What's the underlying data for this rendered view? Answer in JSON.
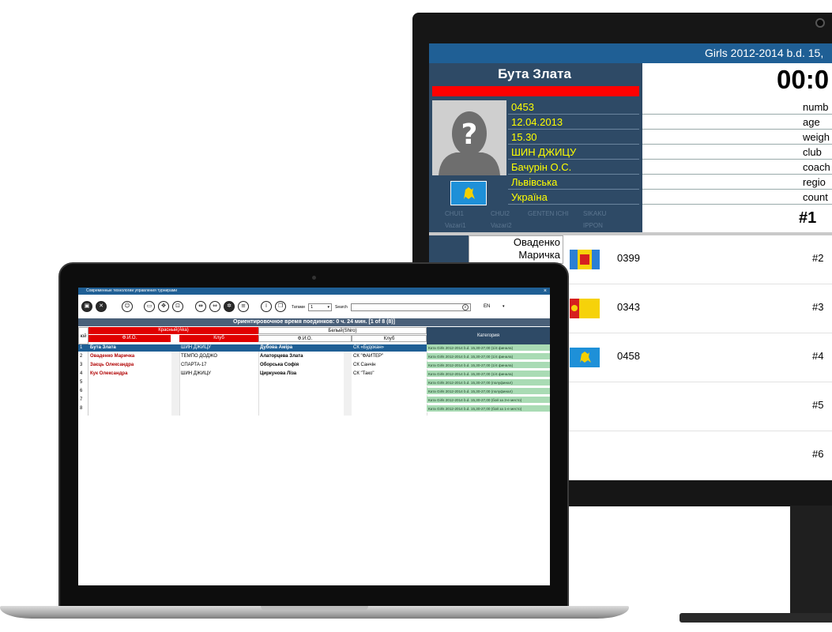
{
  "monitor": {
    "title": "Girls 2012-2014 b.d. 15,",
    "athlete_name": "Бута Злата",
    "timer": "00:0",
    "info": [
      "0453",
      "12.04.2013",
      "15.30",
      "ШИН ДЖИЦУ",
      "Бачурін О.С.",
      "Львівська",
      "Україна"
    ],
    "field_labels": [
      "numb",
      "age",
      "weigh",
      "club",
      "coach",
      "regio",
      "count"
    ],
    "rank": "#1",
    "score_labels": [
      "CHUI1",
      "CHUI2",
      "GENTEN ICHI",
      "SIKAKU",
      "Vazari1",
      "Vazari2",
      "IPPON"
    ],
    "queue_name": "Оваденко Маричка",
    "queue": [
      {
        "number": "0399",
        "rank": "#2",
        "flag": "flag-icon"
      },
      {
        "number": "0343",
        "rank": "#3",
        "flag": "flag-icon"
      },
      {
        "number": "0458",
        "rank": "#4",
        "flag": "flag-icon"
      },
      {
        "number": "",
        "rank": "#5",
        "flag": ""
      },
      {
        "number": "",
        "rank": "#6",
        "flag": ""
      }
    ],
    "colors": {
      "header": "#1f5f95",
      "panel": "#2e4a66",
      "red": "#ff0000",
      "yellow": "#ffff00"
    }
  },
  "laptop": {
    "window_title": "Современные технологии управления турнирами",
    "close": "×",
    "tatami_label": "Татами",
    "tatami_value": "1",
    "search_label": "Search",
    "language": "EN",
    "status": "Ориентировочное время поединков: 0 ч. 24 мин.   [1 of 8 (8)]",
    "headers": {
      "num": "юй",
      "red": "Красный(Aka)",
      "white": "Белый(Shiro)",
      "fio": "Ф.И.О.",
      "club": "Клуб",
      "category": "Категория"
    },
    "rows": [
      {
        "n": "1",
        "red_fio": "Бута Злата",
        "red_club": "ШИН ДЖИЦУ",
        "white_fio": "Дубова Аміра",
        "white_club": "СК «Будокан»",
        "cat": "Ката Girls 2012-2014 b.d. 15,30-27,00 (1/4 финала)"
      },
      {
        "n": "2",
        "red_fio": "Оваденко Маричка",
        "red_club": "ТЕМПО ДОДЖО",
        "white_fio": "Алаторцева Злата",
        "white_club": "СК \"ФАЙТЕР\"",
        "cat": "Ката Girls 2012-2014 b.d. 15,30-27,00 (1/4 финала)"
      },
      {
        "n": "3",
        "red_fio": "Заєць Олександра",
        "red_club": "СПАРТА-17",
        "white_fio": "Оборська Софія",
        "white_club": "СК Санчін",
        "cat": "Ката Girls 2012-2014 b.d. 15,30-27,00 (1/4 финала)"
      },
      {
        "n": "4",
        "red_fio": "Кук Олександра",
        "red_club": "ШИН ДЖИЦУ",
        "white_fio": "Циркунова Ліза",
        "white_club": "СК \"Тако\"",
        "cat": "Ката Girls 2012-2014 b.d. 15,30-27,00 (1/4 финала)"
      },
      {
        "n": "5",
        "red_fio": "",
        "red_club": "",
        "white_fio": "",
        "white_club": "",
        "cat": "Ката Girls 2012-2014 b.d. 15,30-27,00 (полуфинал)"
      },
      {
        "n": "6",
        "red_fio": "",
        "red_club": "",
        "white_fio": "",
        "white_club": "",
        "cat": "Ката Girls 2012-2014 b.d. 15,30-27,00 (полуфинал)"
      },
      {
        "n": "7",
        "red_fio": "",
        "red_club": "",
        "white_fio": "",
        "white_club": "",
        "cat": "Ката Girls 2012-2014 b.d. 15,30-27,00 (бой за 3-е место)"
      },
      {
        "n": "8",
        "red_fio": "",
        "red_club": "",
        "white_fio": "",
        "white_club": "",
        "cat": "Ката Girls 2012-2014 b.d. 15,30-27,00 (бой за 1-е место)"
      }
    ],
    "colors": {
      "titlebar": "#1f5f95",
      "red": "#e00000",
      "category": "#a9dbb4",
      "selected": "#1f5f95"
    }
  }
}
